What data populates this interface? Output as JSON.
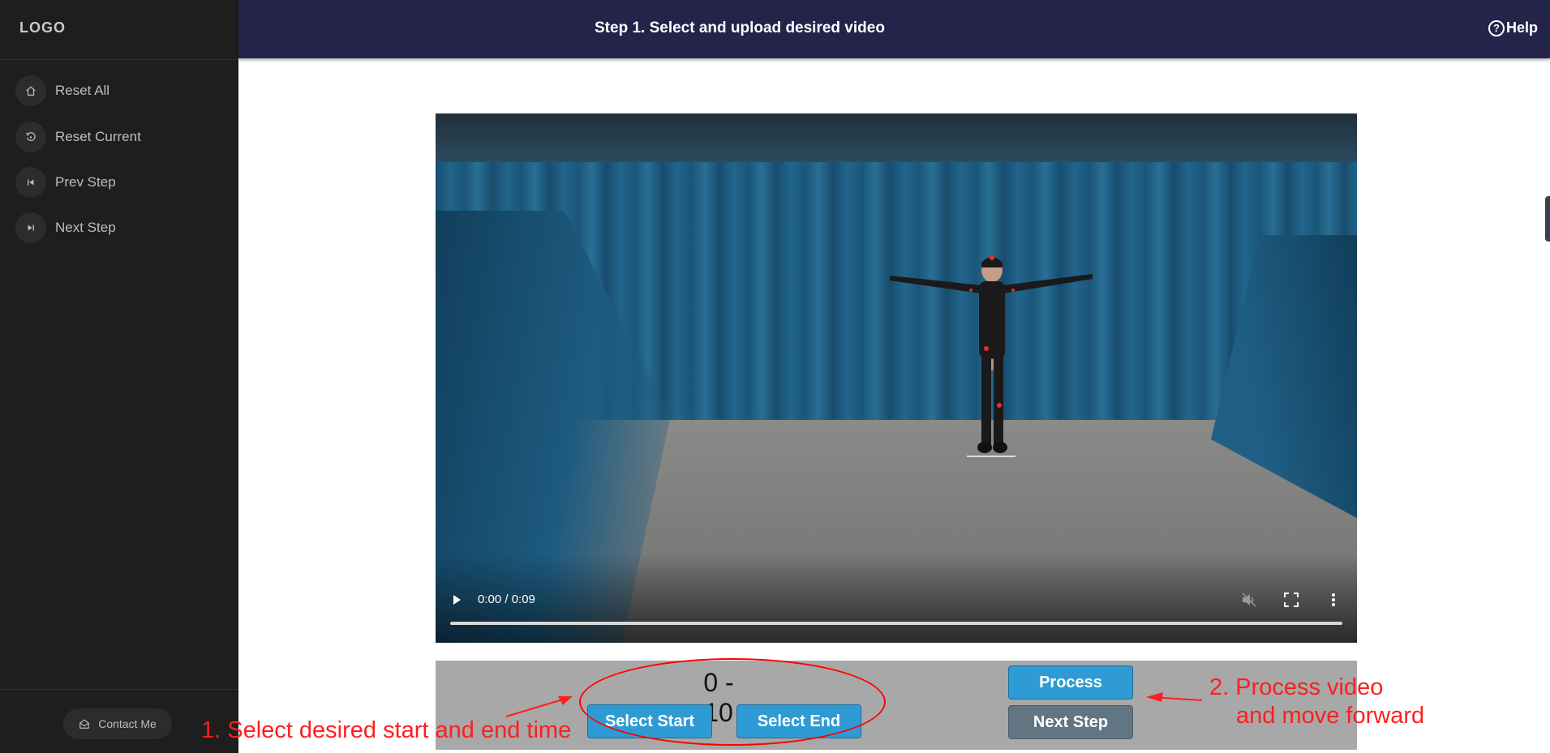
{
  "sidebar": {
    "logo": "LOGO",
    "items": [
      {
        "label": "Reset All",
        "icon": "home-icon"
      },
      {
        "label": "Reset Current",
        "icon": "reset-icon"
      },
      {
        "label": "Prev Step",
        "icon": "prev-step-icon"
      },
      {
        "label": "Next Step",
        "icon": "next-step-icon"
      }
    ],
    "contact_label": "Contact Me"
  },
  "header": {
    "title": "Step 1. Select and upload desired video",
    "help_label": "Help"
  },
  "video": {
    "time": "0:00 / 0:09",
    "progress": 0
  },
  "controls": {
    "range": "0 - 10",
    "select_start": "Select Start",
    "select_end": "Select End",
    "process": "Process",
    "next_step": "Next Step"
  },
  "annotations": {
    "left": "1. Select desired start and end time",
    "right_line1": "2. Process video",
    "right_line2": "and move forward"
  },
  "colors": {
    "sidebar": "#1e1e1e",
    "header": "#24244a",
    "button_blue": "#2f9bd4",
    "button_gray": "#627583",
    "annotation_red": "#ff1e1e"
  }
}
